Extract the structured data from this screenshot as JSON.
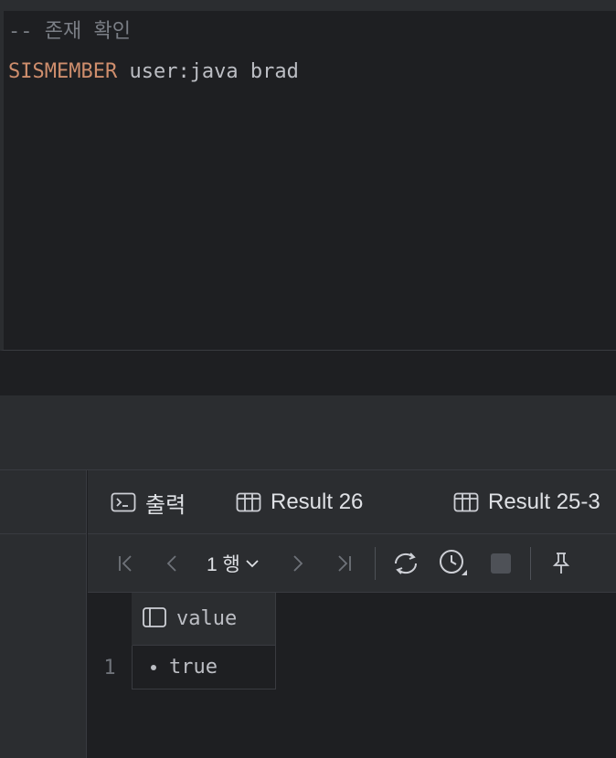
{
  "editor": {
    "comment": "-- 존재 확인",
    "keyword": "SISMEMBER",
    "args": " user:java brad"
  },
  "tabs": [
    {
      "label": "출력",
      "icon": "console-icon"
    },
    {
      "label": "Result 26",
      "icon": "table-icon"
    },
    {
      "label": "Result 25-3",
      "icon": "table-icon"
    }
  ],
  "toolbar": {
    "page_label": "1 행",
    "icons": [
      "first-page-icon",
      "prev-page-icon",
      "next-page-icon",
      "last-page-icon",
      "refresh-icon",
      "history-icon",
      "stop-icon",
      "pin-icon"
    ]
  },
  "grid": {
    "columns": [
      "value"
    ],
    "rows": [
      {
        "num": "1",
        "value": "true"
      }
    ]
  },
  "colors": {
    "background": "#1e1f22",
    "panel": "#2b2d30",
    "keyword": "#cf8e6d",
    "comment": "#7a7e85",
    "text": "#bcbec4"
  }
}
